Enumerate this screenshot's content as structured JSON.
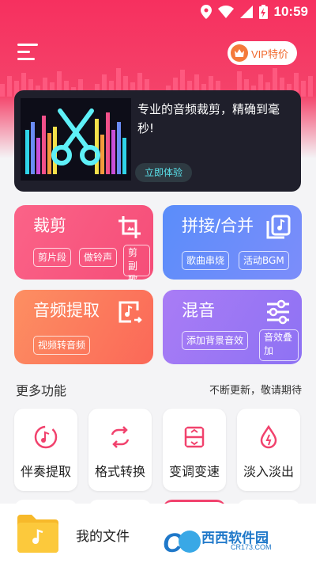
{
  "status_bar": {
    "time": "10:59",
    "icons": [
      "location-icon",
      "wifi-icon",
      "signal-icon",
      "battery-charging-icon"
    ]
  },
  "header": {
    "menu_icon": "menu-icon",
    "vip_label": "VIP特价",
    "vip_icon": "crown-icon"
  },
  "banner": {
    "text": "专业的音频裁剪，精确到毫秒!",
    "button_label": "立即体验",
    "art_icon": "scissors-icon"
  },
  "feature_cards": [
    {
      "title": "裁剪",
      "icon": "crop-icon",
      "tags": [
        "剪片段",
        "做铃声",
        "剪副歌"
      ]
    },
    {
      "title": "拼接/合并",
      "icon": "copy-music-icon",
      "tags": [
        "歌曲串烧",
        "活动BGM"
      ]
    },
    {
      "title": "音频提取",
      "icon": "music-export-icon",
      "tags": [
        "视频转音频"
      ]
    },
    {
      "title": "混音",
      "icon": "sliders-icon",
      "tags": [
        "添加背景音效",
        "音效叠加"
      ]
    }
  ],
  "more_section": {
    "title": "更多功能",
    "hint": "不断更新，敬请期待",
    "tools": [
      {
        "label": "伴奏提取",
        "icon": "accompaniment-icon"
      },
      {
        "label": "格式转换",
        "icon": "convert-icon"
      },
      {
        "label": "变调变速",
        "icon": "pitch-speed-icon"
      },
      {
        "label": "淡入淡出",
        "icon": "fade-icon"
      }
    ]
  },
  "bottom_bar": {
    "files_label": "我的文件",
    "folder_icon": "music-folder-icon"
  },
  "watermark": {
    "text": "西西软件园",
    "sub": "CR173.COM"
  },
  "colors": {
    "header_red": "#f6305f",
    "accent_pink": "#f1426d",
    "card_crop": "#fb6388",
    "card_merge": "#5a8dfa",
    "card_extract": "#fd8f62",
    "card_mix": "#a97cf5",
    "vip_orange": "#f0682c",
    "banner_button_text": "#59e0e9"
  }
}
